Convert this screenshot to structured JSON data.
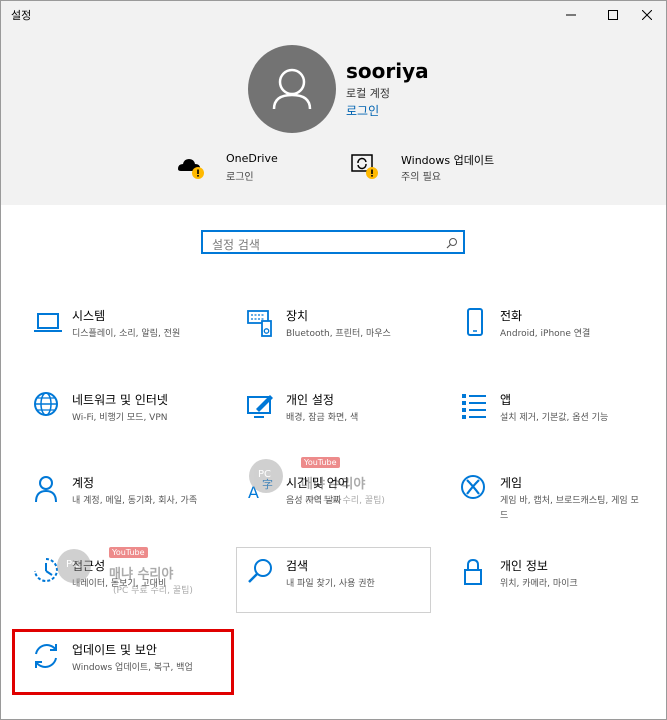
{
  "window": {
    "title": "설정"
  },
  "account": {
    "name": "sooriya",
    "type": "로컬 계정",
    "signin_link": "로그인"
  },
  "status": [
    {
      "title": "OneDrive",
      "subtitle": "로그인",
      "icon": "onedrive-icon"
    },
    {
      "title": "Windows 업데이트",
      "subtitle": "주의 필요",
      "icon": "windows-update-icon"
    }
  ],
  "search": {
    "placeholder": "설정 검색"
  },
  "categories": [
    {
      "title": "시스템",
      "subtitle": "디스플레이, 소리, 알림, 전원",
      "icon": "laptop-icon"
    },
    {
      "title": "장치",
      "subtitle": "Bluetooth, 프린터, 마우스",
      "icon": "devices-icon"
    },
    {
      "title": "전화",
      "subtitle": "Android, iPhone 연결",
      "icon": "phone-icon"
    },
    {
      "title": "네트워크 및 인터넷",
      "subtitle": "Wi-Fi, 비행기 모드, VPN",
      "icon": "globe-icon"
    },
    {
      "title": "개인 설정",
      "subtitle": "배경, 잠금 화면, 색",
      "icon": "personalization-icon"
    },
    {
      "title": "앱",
      "subtitle": "설치 제거, 기본값, 옵션 기능",
      "icon": "apps-icon"
    },
    {
      "title": "계정",
      "subtitle": "내 계정, 메일, 동기화, 회사, 가족",
      "icon": "person-icon"
    },
    {
      "title": "시간 및 언어",
      "subtitle": "음성 지역 날짜",
      "icon": "time-language-icon"
    },
    {
      "title": "게임",
      "subtitle": "게임 바, 캡처, 브로드캐스팅, 게임 모드",
      "icon": "xbox-icon"
    },
    {
      "title": "접근성",
      "subtitle": "내레이터, 돋보기, 고대비",
      "icon": "accessibility-icon"
    },
    {
      "title": "검색",
      "subtitle": "내 파일 찾기, 사용 권한",
      "icon": "search-icon"
    },
    {
      "title": "개인 정보",
      "subtitle": "위치, 카메라, 마이크",
      "icon": "lock-icon"
    },
    {
      "title": "업데이트 및 보안",
      "subtitle": "Windows 업데이트, 복구, 백업",
      "icon": "update-sync-icon"
    }
  ],
  "watermark": {
    "badge": "YouTube",
    "brand": "매냐 수리야",
    "sub": "(PC 무료 수리, 꿀팁)",
    "logo_text": "PC"
  },
  "colors": {
    "accent": "#0078d7",
    "warning": "#ffb900",
    "header_bg": "#f2f2f2",
    "highlight": "#e00000"
  }
}
